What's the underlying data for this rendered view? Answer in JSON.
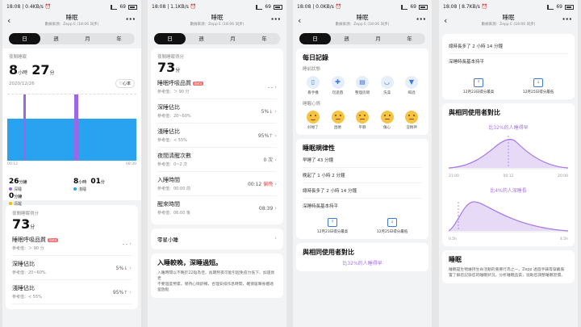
{
  "status": {
    "p1": "18:08 | 0.4KB/s ⏰",
    "p2": "18:08 | 1.1KB/s ⏰",
    "p3": "18:08 | 0.0KB/s ⏰",
    "p4": "18:08 | 8.7KB/s ⏰",
    "bat": "69"
  },
  "header": {
    "title": "睡眠",
    "subtitle": "數據來源：Zepp E (18:06 同步)"
  },
  "tabs": [
    "日",
    "週",
    "月",
    "年"
  ],
  "p1": {
    "label": "夜間睡眠",
    "h": "8",
    "hu": "小時",
    "m": "27",
    "mu": "分",
    "date": "2020/12/26",
    "hr_btn": "♡心率",
    "t_start": "00:12",
    "t_end": "08:39",
    "deep_v": "26",
    "deep_u": "分鐘",
    "deep_l": "深睡",
    "light_h": "8",
    "light_hu": "小時",
    "light_m": "01",
    "light_mu": "分",
    "light_l": "淺睡",
    "rem_v": "0",
    "rem_u": "分鐘",
    "rem_l": "清醒",
    "score_label": "夜間睡眠得分",
    "score": "73",
    "score_u": "分",
    "items": [
      {
        "name": "睡眠呼吸品質",
        "beta": "Beta",
        "sub": "參考值：＞ 90 分",
        "val": "- -"
      },
      {
        "name": "深睡佔比",
        "sub": "參考值：20~60%",
        "val": "5%",
        "flag": "↓"
      },
      {
        "name": "淺睡佔比",
        "sub": "參考值：< 55%",
        "val": "95%",
        "flag": "↑"
      }
    ]
  },
  "p2": {
    "score_label": "夜間睡眠得分",
    "score": "73",
    "score_u": "分",
    "items": [
      {
        "name": "睡眠呼吸品質",
        "beta": "Beta",
        "sub": "參考值：＞ 90 分",
        "val": "- -"
      },
      {
        "name": "深睡佔比",
        "sub": "參考值：20~60%",
        "val": "5%",
        "flag": "↓"
      },
      {
        "name": "淺睡佔比",
        "sub": "參考值：< 55%",
        "val": "95%",
        "flag": "↑"
      },
      {
        "name": "夜間清醒次數",
        "sub": "參考值：0~2 次",
        "val": "0 次"
      },
      {
        "name": "入睡時間",
        "sub": "參考值：00:00 前",
        "val": "00:12",
        "flag": "偏晚"
      },
      {
        "name": "醒來時間",
        "sub": "參考值：06:00 後",
        "val": "08:39"
      }
    ],
    "nap": "零星小睡",
    "tip_title": "入睡較晚，深睡過短。",
    "tip_body": "入睡時間以不晚於22點為佳，長期熬夜可能引起免疫力低下、加速衰老\n不要過度勞累，保持心情舒暢，合理安排作息時間，確保居陣身體適當放鬆"
  },
  "p3": {
    "title": "每日記錄",
    "before": "睡前狀態",
    "states": [
      "看手機",
      "玩遊戲",
      "整理房間",
      "洗澡",
      "喝酒"
    ],
    "mood": "睡醒心情",
    "moods": [
      "好極了",
      "困倦",
      "平靜",
      "傷心",
      "沒精神"
    ],
    "reg_title": "睡眠規律性",
    "reg": [
      "早睡了 43 分鐘",
      "晚起了 1 小時 2 分鐘",
      "總時長多了 2 小時 14 分鐘",
      "深睡時長基本持平"
    ],
    "hi": "12月23日得分最高",
    "lo": "12月25日得分最低",
    "cmp_title": "與相同使用者對比",
    "cmp_label": "比32%的人睡得早"
  },
  "p4": {
    "reg": [
      "總時長多了 2 小時 14 分鐘",
      "深睡時長基本持平"
    ],
    "hi": "12月23日得分最高",
    "lo": "12月25日得分最低",
    "cmp_title": "與相同使用者對比",
    "cmp1": "比32%的人睡得早",
    "ax1": [
      "21:00",
      "00:12",
      "20:00"
    ],
    "cmp2": "比4%的人深睡長",
    "ax2": [
      "0.5h",
      "4.5h"
    ],
    "about_title": "睡眠",
    "about_body": "睡眠是生物維持生命活動的重要行為之一。Zepp 透過手錶等穿戴裝置了解您記錄您的睡眠狀況，分析睡眠品質，協助您調整睡眠習慣。"
  }
}
